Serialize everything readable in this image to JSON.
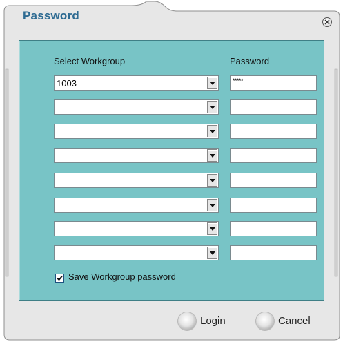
{
  "window": {
    "title": "Password"
  },
  "form": {
    "workgroup_header": "Select Workgroup",
    "password_header": "Password",
    "rows": [
      {
        "workgroup": "1003",
        "password_mask": "*****"
      },
      {
        "workgroup": "",
        "password_mask": ""
      },
      {
        "workgroup": "",
        "password_mask": ""
      },
      {
        "workgroup": "",
        "password_mask": ""
      },
      {
        "workgroup": "",
        "password_mask": ""
      },
      {
        "workgroup": "",
        "password_mask": ""
      },
      {
        "workgroup": "",
        "password_mask": ""
      },
      {
        "workgroup": "",
        "password_mask": ""
      }
    ],
    "save_checkbox_label": "Save Workgroup password",
    "save_checked": true
  },
  "buttons": {
    "login": "Login",
    "cancel": "Cancel"
  },
  "icons": {
    "close": "close-circle-icon",
    "dropdown": "chevron-down-icon",
    "check": "checkmark-icon"
  },
  "colors": {
    "title": "#2e6b92",
    "panel": "#78c4c6",
    "panel_border": "#3f7f86",
    "frame": "#e7e7e7"
  }
}
